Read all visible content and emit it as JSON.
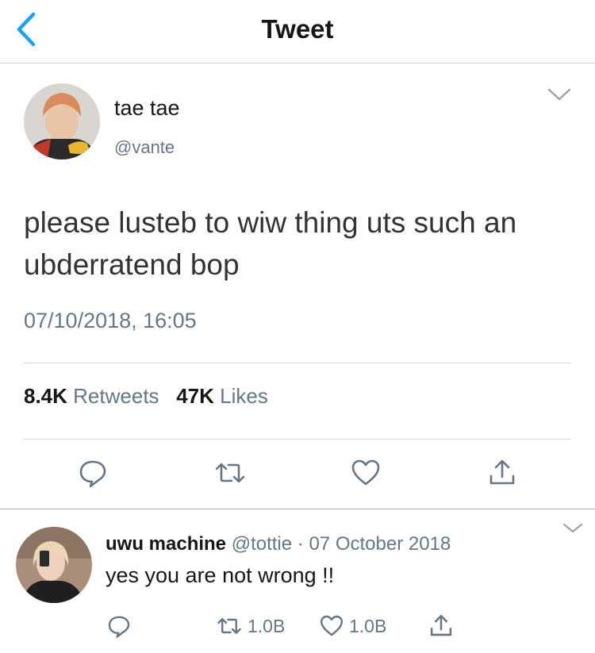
{
  "nav": {
    "title": "Tweet"
  },
  "tweet": {
    "author_name": "tae tae",
    "author_handle": "@vante",
    "text": "please lusteb to wiw thing uts such an ubderratend bop",
    "timestamp": "07/10/2018, 16:05",
    "retweets_count": "8.4K",
    "retweets_label": "Retweets",
    "likes_count": "47K",
    "likes_label": "Likes"
  },
  "reply": {
    "author_name": "uwu machine",
    "author_handle": "@tottie",
    "separator": "·",
    "date": "07 October 2018",
    "text": "yes you are not wrong !!",
    "retweets_count": "1.0B",
    "likes_count": "1.0B"
  },
  "icons": [
    "back-chevron-icon",
    "caret-down-icon",
    "reply-icon",
    "retweet-icon",
    "like-icon",
    "share-icon"
  ],
  "colors": {
    "accent": "#1da1f2",
    "muted": "#657786",
    "text": "#14171a"
  }
}
